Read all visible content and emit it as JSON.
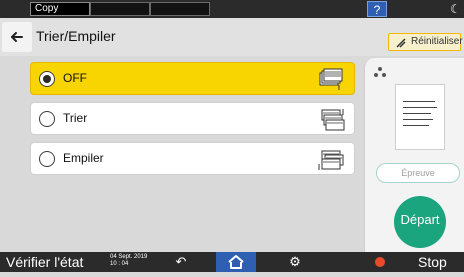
{
  "topbar": {
    "tabs": [
      {
        "label": "Copy"
      },
      {
        "label": ""
      },
      {
        "label": ""
      }
    ],
    "help_label": "?"
  },
  "header": {
    "title": "Trier/Empiler",
    "reset_label": "Réinitialiser"
  },
  "options": [
    {
      "label": "OFF",
      "selected": true
    },
    {
      "label": "Trier",
      "selected": false
    },
    {
      "label": "Empiler",
      "selected": false
    }
  ],
  "right_panel": {
    "preview_label": "Épreuve",
    "start_label": "Départ"
  },
  "bottombar": {
    "status_label": "Vérifier l'état",
    "date": "04 Sept. 2019",
    "time": "10 : 04",
    "stop_label": "Stop"
  },
  "colors": {
    "selected": "#f8d400",
    "start": "#1aa57e",
    "home": "#2f5fb3",
    "stop": "#e84b2a"
  }
}
